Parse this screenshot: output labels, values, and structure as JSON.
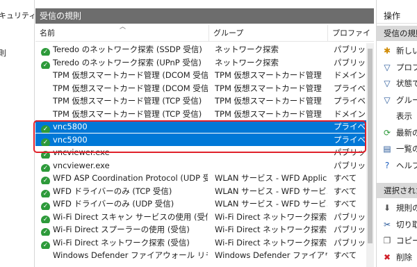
{
  "left_pane": {
    "items": [
      {
        "label": "キュリティ"
      },
      {
        "label": "則"
      }
    ]
  },
  "center": {
    "pane_title": "受信の規則",
    "columns": {
      "name": "名前",
      "group": "グループ",
      "profile": "プロファイ"
    },
    "rows": [
      {
        "enabled": true,
        "name": "Teredo のネットワーク探索 (SSDP 受信)",
        "group": "ネットワーク探索",
        "profile": "パブリック"
      },
      {
        "enabled": true,
        "name": "Teredo のネットワーク探索 (UPnP 受信)",
        "group": "ネットワーク探索",
        "profile": "パブリック"
      },
      {
        "enabled": false,
        "name": "TPM 仮想スマートカード管理 (DCOM 受信)",
        "group": "TPM 仮想スマートカード管理",
        "profile": "ドメイン"
      },
      {
        "enabled": false,
        "name": "TPM 仮想スマートカード管理 (DCOM 受信)",
        "group": "TPM 仮想スマートカード管理",
        "profile": "プライベー"
      },
      {
        "enabled": false,
        "name": "TPM 仮想スマートカード管理 (TCP 受信)",
        "group": "TPM 仮想スマートカード管理",
        "profile": "プライベー"
      },
      {
        "enabled": false,
        "name": "TPM 仮想スマートカード管理 (TCP 受信)",
        "group": "TPM 仮想スマートカード管理",
        "profile": "ドメイン"
      },
      {
        "enabled": true,
        "name": "vnc5800",
        "group": "",
        "profile": "プライベー",
        "selected": true
      },
      {
        "enabled": true,
        "name": "vnc5900",
        "group": "",
        "profile": "プライベー",
        "selected": true
      },
      {
        "enabled": true,
        "name": "vncviewer.exe",
        "group": "",
        "profile": "パブリック"
      },
      {
        "enabled": true,
        "name": "vncviewer.exe",
        "group": "",
        "profile": "パブリック"
      },
      {
        "enabled": true,
        "name": "WFD ASP Coordination Protocol (UDP 受信)",
        "group": "WLAN サービス - WFD Applic...",
        "profile": "すべて"
      },
      {
        "enabled": true,
        "name": "WFD ドライバーのみ (TCP 受信)",
        "group": "WLAN サービス - WFD サービ...",
        "profile": "すべて"
      },
      {
        "enabled": true,
        "name": "WFD ドライバーのみ (UDP 受信)",
        "group": "WLAN サービス - WFD サービ...",
        "profile": "すべて"
      },
      {
        "enabled": true,
        "name": "Wi-Fi Direct スキャン サービスの使用 (受信)",
        "group": "Wi-Fi Direct ネットワーク探索",
        "profile": "パブリック"
      },
      {
        "enabled": true,
        "name": "Wi-Fi Direct スプーラーの使用 (受信)",
        "group": "Wi-Fi Direct ネットワーク探索",
        "profile": "パブリック"
      },
      {
        "enabled": true,
        "name": "Wi-Fi Direct ネットワーク探索 (受信)",
        "group": "Wi-Fi Direct ネットワーク探索",
        "profile": "パブリック"
      },
      {
        "enabled": false,
        "name": "Windows Defender ファイアウォール リモート...",
        "group": "Windows Defender ファイアウ...",
        "profile": "すべて"
      }
    ]
  },
  "actions": {
    "title": "操作",
    "section1": "受信の規則",
    "items1": [
      {
        "icon": "new-rule-icon",
        "glyph": "✱",
        "color": "#d08a00",
        "label": "新しい規則..."
      },
      {
        "icon": "filter-icon",
        "glyph": "▽",
        "color": "#2a5a9a",
        "label": "プロファイルでフィルター"
      },
      {
        "icon": "filter-icon",
        "glyph": "▽",
        "color": "#2a5a9a",
        "label": "状態でフィルター"
      },
      {
        "icon": "filter-icon",
        "glyph": "▽",
        "color": "#2a5a9a",
        "label": "グループでフィルター"
      },
      {
        "icon": "none",
        "glyph": "",
        "color": "#000",
        "label": "表示"
      },
      {
        "icon": "refresh-icon",
        "glyph": "⟳",
        "color": "#2d9a3a",
        "label": "最新の情報に更新"
      },
      {
        "icon": "export-icon",
        "glyph": "▤",
        "color": "#2a5a9a",
        "label": "一覧のエクスポート..."
      },
      {
        "icon": "help-icon",
        "glyph": "?",
        "color": "#1f5fbf",
        "label": "ヘルプ"
      }
    ],
    "section2": "選択された項目",
    "items2": [
      {
        "icon": "disable-rule-icon",
        "glyph": "⬇",
        "color": "#555",
        "label": "規則の無効化"
      },
      {
        "icon": "cut-icon",
        "glyph": "✂",
        "color": "#2a5a9a",
        "label": "切り取り"
      },
      {
        "icon": "copy-icon",
        "glyph": "❐",
        "color": "#555",
        "label": "コピー"
      },
      {
        "icon": "delete-icon",
        "glyph": "✖",
        "color": "#d0202a",
        "label": "削除"
      }
    ]
  }
}
